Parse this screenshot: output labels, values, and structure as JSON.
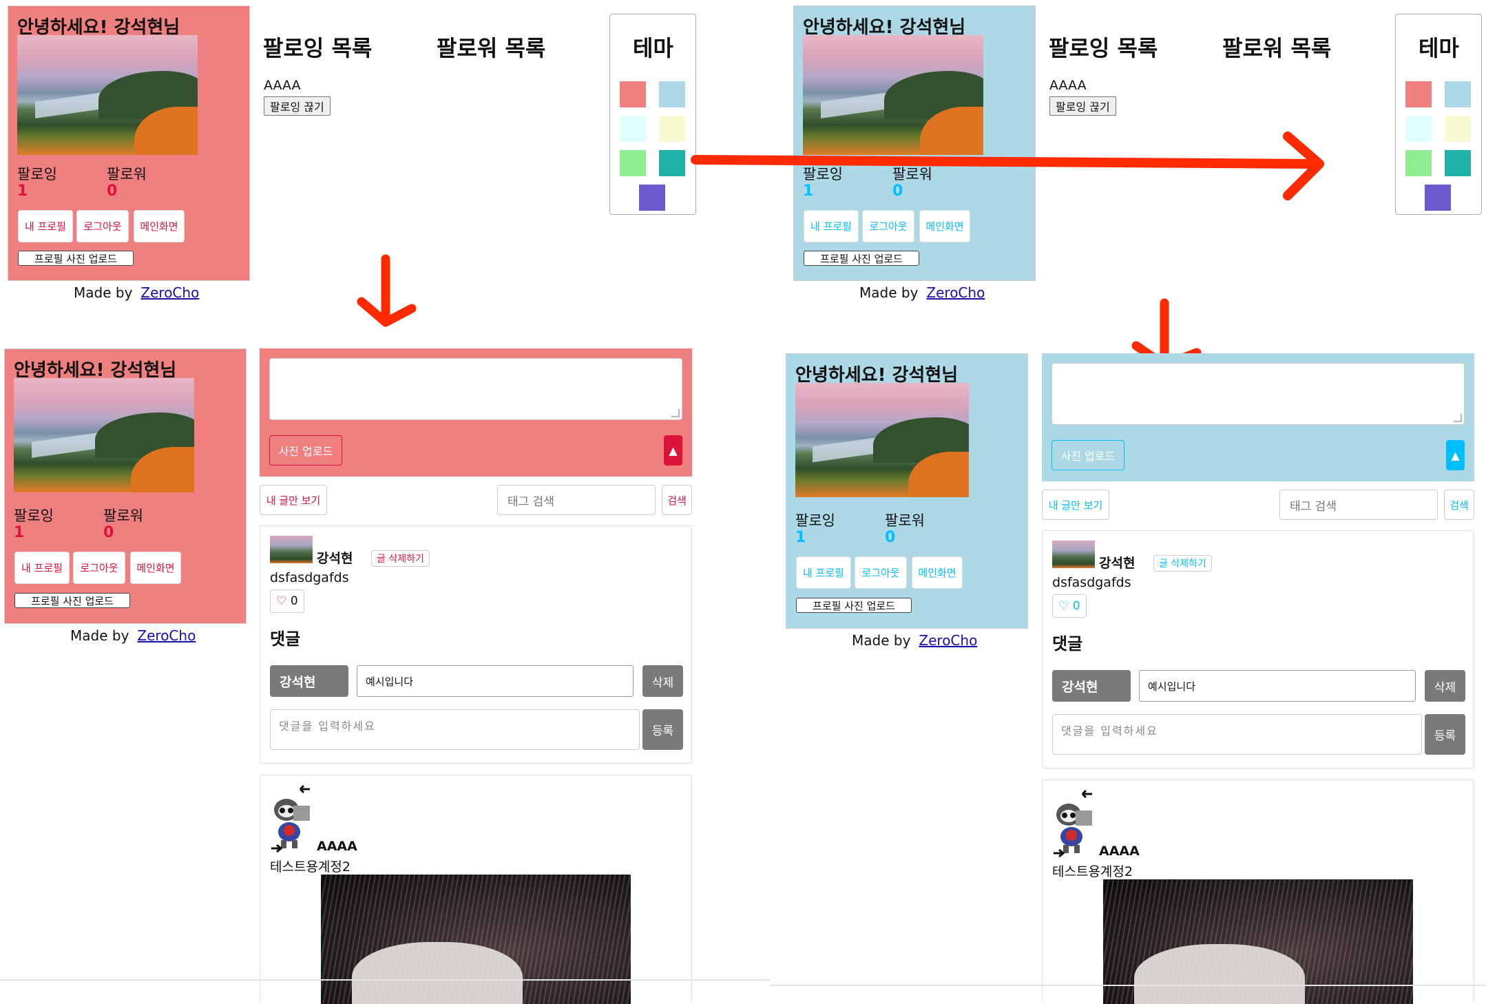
{
  "profile": {
    "greeting": "안녕하세요! 강석현님",
    "following_label": "팔로잉",
    "follower_label": "팔로워",
    "following_count": "1",
    "follower_count": "0",
    "my_profile": "내 프로필",
    "logout": "로그아웃",
    "main_page": "메인화면",
    "upload_photo": "프로필 사진 업로드",
    "made_by": "Made by",
    "made_by_link": "ZeroCho"
  },
  "lists": {
    "following_title": "팔로잉 목록",
    "follower_title": "팔로워 목록",
    "following_user": "AAAA",
    "unfollow": "팔로잉 끊기"
  },
  "theme": {
    "title": "테마",
    "swatches": [
      "#f08080",
      "#add8e6",
      "#e0ffff",
      "#fafad2",
      "#90ee90",
      "#20b2aa",
      "#6a5acd"
    ]
  },
  "themes": {
    "coral": {
      "bg": "#f08080",
      "accent": "#dc143c"
    },
    "blue": {
      "bg": "#add8e6",
      "accent": "#00bfff"
    }
  },
  "arrow_color": "#ff2a00",
  "feed": {
    "photo_upload": "사진 업로드",
    "up": "▲",
    "my_posts": "내 글만 보기",
    "tag_search_placeholder": "태그 검색",
    "search": "검색",
    "post1": {
      "author": "강석현",
      "delete": "글 삭제하기",
      "content": "dsfasdgafds",
      "like_icon": "♡",
      "likes": "0",
      "comments_title": "댓글",
      "comment_author": "강석현",
      "comment_text": "예시입니다",
      "comment_delete": "삭제",
      "comment_placeholder": "댓글을 입력하세요",
      "comment_submit": "등록"
    },
    "post2": {
      "author": "AAAA",
      "content": "테스트용계정2"
    }
  }
}
